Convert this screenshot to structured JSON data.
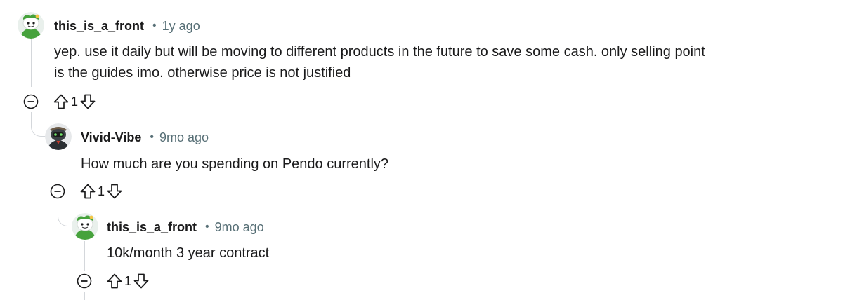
{
  "comments": [
    {
      "author": "this_is_a_front",
      "separator": "•",
      "time": "1y ago",
      "body_lines": [
        "yep. use it daily but will be moving to different products in the future to save some cash. only selling point",
        "is the guides imo. otherwise price is not justified"
      ],
      "score": "1",
      "avatar_icon": "snoo-avatar-green-icon"
    },
    {
      "author": "Vivid-Vibe",
      "separator": "•",
      "time": "9mo ago",
      "body_lines": [
        "How much are you spending on Pendo currently?"
      ],
      "score": "1",
      "avatar_icon": "snoo-avatar-dark-icon"
    },
    {
      "author": "this_is_a_front",
      "separator": "•",
      "time": "9mo ago",
      "body_lines": [
        "10k/month 3 year contract"
      ],
      "score": "1",
      "avatar_icon": "snoo-avatar-green-icon"
    }
  ],
  "colors": {
    "text": "#1a1a1b",
    "meta": "#576f76",
    "thread_line": "#d4d7db",
    "avatar_green": "#46a23c"
  }
}
